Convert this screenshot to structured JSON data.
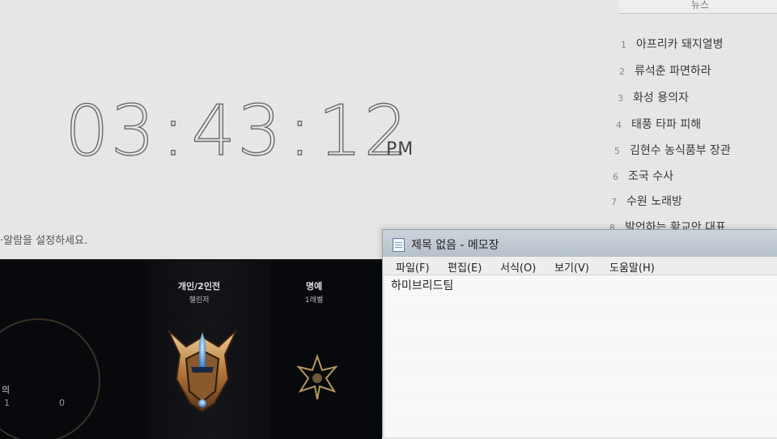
{
  "clock": {
    "hours": "03",
    "minutes": "43",
    "seconds": "12",
    "ampm": "PM",
    "sep": ":"
  },
  "alarm_hint": "·알람을 설정하세요.",
  "news": {
    "header": "뉴스",
    "items": [
      {
        "num": "1",
        "title": "아프리카 돼지열병"
      },
      {
        "num": "2",
        "title": "류석춘 파면하라"
      },
      {
        "num": "3",
        "title": "화성 용의자"
      },
      {
        "num": "4",
        "title": "태풍 타파 피해"
      },
      {
        "num": "5",
        "title": "김현수 농식품부 장관"
      },
      {
        "num": "6",
        "title": "조국 수사"
      },
      {
        "num": "7",
        "title": "수원 노래방"
      },
      {
        "num": "8",
        "title": "발언하는 황교안 대표"
      }
    ]
  },
  "game": {
    "ranked_title": "개인/2인전",
    "ranked_sub": "챌린저",
    "honor_title": "명예",
    "honor_sub": "1레벨",
    "left_label": "의",
    "left_num_a": "1",
    "left_num_b": "0"
  },
  "notepad": {
    "title": "제목 없음 - 메모장",
    "menus": [
      "파일(F)",
      "편집(E)",
      "서식(O)",
      "보기(V)",
      "도움말(H)"
    ],
    "content": "하미브리드팀"
  },
  "colors": {
    "background": "#e9e9ea",
    "game_bg": "#07090d",
    "notepad_title": "#c3ccd5"
  }
}
